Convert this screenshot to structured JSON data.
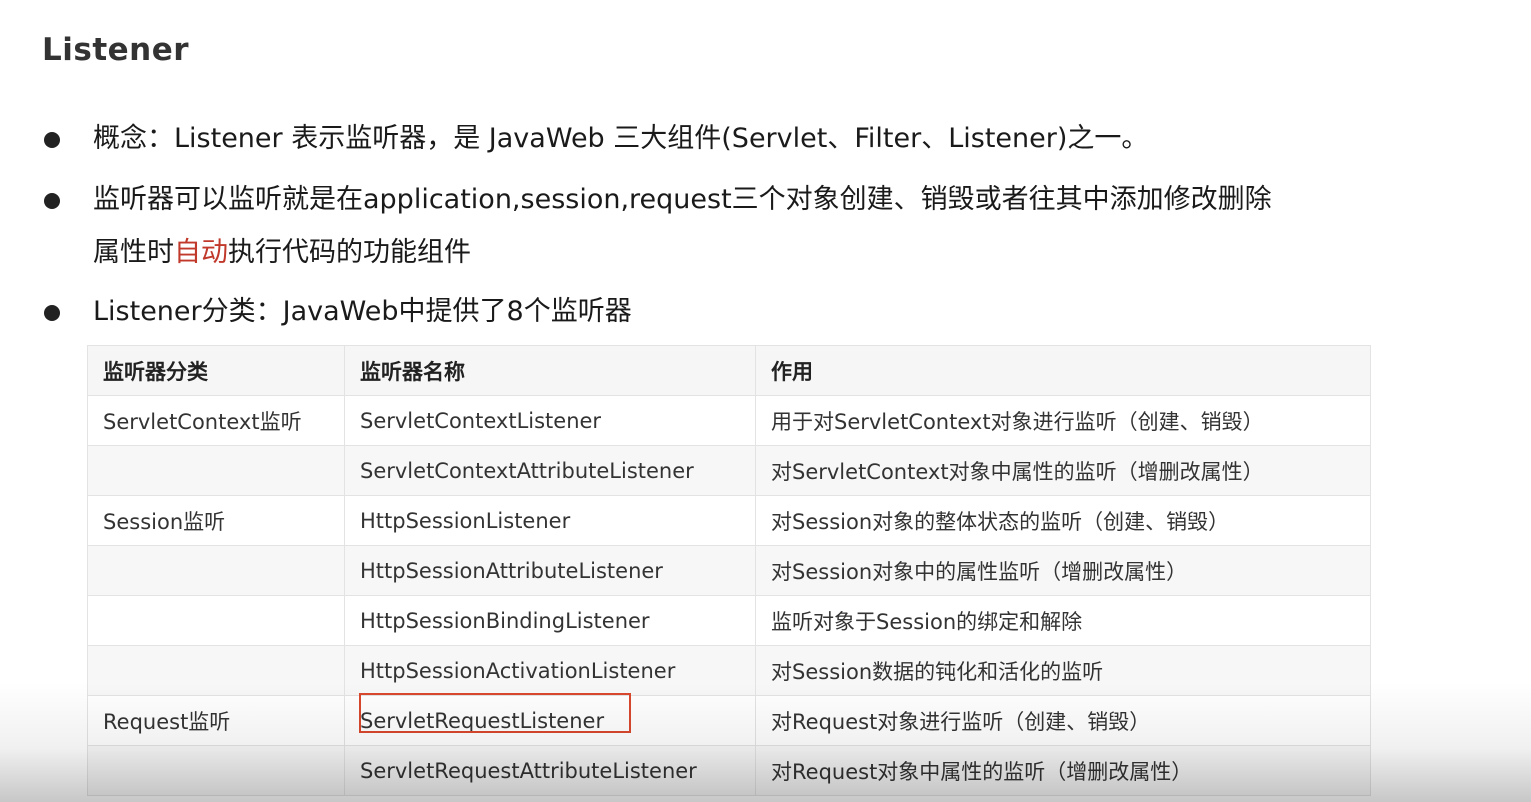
{
  "slide": {
    "title": "Listener",
    "bullets": [
      {
        "text": "概念：Listener 表示监听器，是 JavaWeb 三大组件(Servlet、Filter、Listener)之一。"
      },
      {
        "line1": "监听器可以监听就是在application,session,request三个对象创建、销毁或者往其中添加修改删除",
        "line2_before": "属性时",
        "line2_highlight": "自动",
        "line2_after": "执行代码的功能组件"
      },
      {
        "text": "Listener分类：JavaWeb中提供了8个监听器"
      }
    ],
    "highlight_color": "#c0392b"
  },
  "table": {
    "headers": [
      "监听器分类",
      "监听器名称",
      "作用"
    ],
    "rows": [
      [
        "ServletContext监听",
        "ServletContextListener",
        "用于对ServletContext对象进行监听（创建、销毁）"
      ],
      [
        "",
        "ServletContextAttributeListener",
        "对ServletContext对象中属性的监听（增删改属性）"
      ],
      [
        "Session监听",
        "HttpSessionListener",
        "对Session对象的整体状态的监听（创建、销毁）"
      ],
      [
        "",
        "HttpSessionAttributeListener",
        "对Session对象中的属性监听（增删改属性）"
      ],
      [
        "",
        "HttpSessionBindingListener",
        "监听对象于Session的绑定和解除"
      ],
      [
        "",
        "HttpSessionActivationListener",
        "对Session数据的钝化和活化的监听"
      ],
      [
        "Request监听",
        "ServletRequestListener",
        "对Request对象进行监听（创建、销毁）"
      ],
      [
        "",
        "ServletRequestAttributeListener",
        "对Request对象中属性的监听（增删改属性）"
      ]
    ],
    "boxed_cell_color": "#d9482e"
  }
}
